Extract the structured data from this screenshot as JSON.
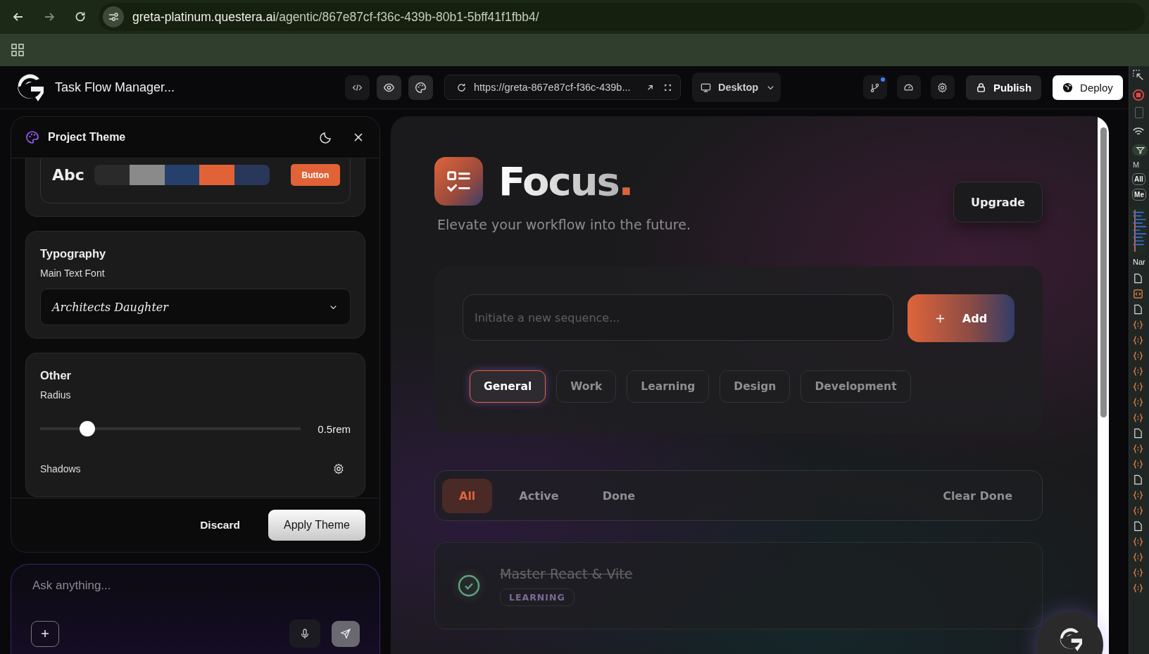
{
  "browser": {
    "url_host": "greta-platinum.questera.ai",
    "url_path": "/agentic/867e87cf-f36c-439b-80b1-5bff41f1fbb4/"
  },
  "app_header": {
    "title": "Task Flow Manager...",
    "view_buttons": [
      {
        "kind": "code",
        "selected": false
      },
      {
        "kind": "preview",
        "selected": true
      },
      {
        "kind": "theme",
        "selected": true
      }
    ],
    "preview_url": "https://greta-867e87cf-f36c-439b...",
    "device": "Desktop",
    "branch_notification": true,
    "actions": [
      {
        "kind": "secondary",
        "label": "Publish"
      },
      {
        "kind": "primary",
        "label": "Deploy"
      }
    ]
  },
  "theme_panel": {
    "title": "Project Theme",
    "preview": {
      "sample": "Abc",
      "button": "Button",
      "swatches": [
        {
          "color": "#2a2a2a"
        },
        {
          "color": "#8a8a8a"
        },
        {
          "color": "#25406b"
        },
        {
          "color": "#e06236"
        },
        {
          "color": "#29375a"
        }
      ]
    },
    "typography": {
      "title": "Typography",
      "label": "Main Text Font",
      "value": "Architects Daughter"
    },
    "other": {
      "title": "Other",
      "radius_label": "Radius",
      "radius": {
        "level": 0.18,
        "reading": "0.5rem"
      },
      "shadows_label": "Shadows"
    },
    "discard": "Discard",
    "apply": "Apply Theme"
  },
  "chat": {
    "placeholder": "Ask anything..."
  },
  "preview": {
    "brand": "Focus",
    "brand_mark": ".",
    "tagline": "Elevate your workflow into the future.",
    "upgrade": "Upgrade",
    "input_placeholder": "Initiate a new sequence...",
    "add": "Add",
    "categories": [
      {
        "label": "General",
        "selected": true
      },
      {
        "label": "Work",
        "selected": false
      },
      {
        "label": "Learning",
        "selected": false
      },
      {
        "label": "Design",
        "selected": false
      },
      {
        "label": "Development",
        "selected": false
      }
    ],
    "filters": [
      {
        "label": "All",
        "selected": true
      },
      {
        "label": "Active",
        "selected": false
      },
      {
        "label": "Done",
        "selected": false
      }
    ],
    "clear": "Clear Done",
    "tasks": [
      {
        "title": "Master React & Vite",
        "done": true,
        "tag": "LEARNING"
      }
    ]
  },
  "devtools": {
    "checkbox_checked": false,
    "texts": [
      "M",
      "All",
      "Me",
      "Nar"
    ],
    "rows": [
      {
        "kind": "doc"
      },
      {
        "kind": "html"
      },
      {
        "kind": "doc"
      },
      {
        "kind": "script"
      },
      {
        "kind": "script"
      },
      {
        "kind": "script"
      },
      {
        "kind": "script"
      },
      {
        "kind": "script"
      },
      {
        "kind": "script"
      },
      {
        "kind": "script"
      },
      {
        "kind": "doc"
      },
      {
        "kind": "script"
      },
      {
        "kind": "script"
      },
      {
        "kind": "doc"
      },
      {
        "kind": "script"
      },
      {
        "kind": "script"
      },
      {
        "kind": "doc"
      },
      {
        "kind": "script"
      },
      {
        "kind": "script"
      },
      {
        "kind": "script"
      },
      {
        "kind": "script"
      }
    ]
  }
}
